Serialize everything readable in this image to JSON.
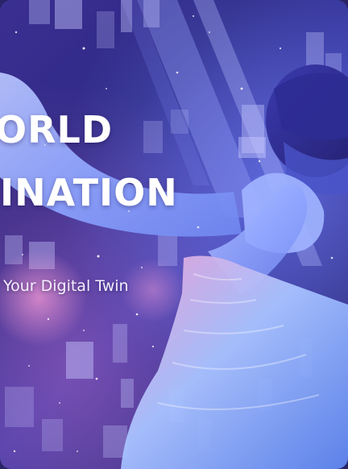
{
  "hero": {
    "headline_line_1": "ORLD",
    "headline_line_2": "INATION",
    "subtitle": "Your Digital Twin"
  },
  "colors": {
    "background_deep": "#2b2468",
    "background_violet": "#3b3aa8",
    "accent_pink": "#e67ac8",
    "accent_blue": "#7fa0ff",
    "text": "#ffffff"
  }
}
